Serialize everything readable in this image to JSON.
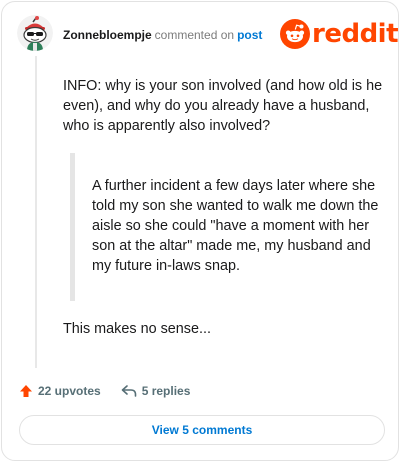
{
  "header": {
    "username": "Zonnebloempje",
    "commented_label": "commented on",
    "post_label": "post",
    "brand": "reddit"
  },
  "icons": {
    "avatar": "snoo-avatar-icon",
    "logo": "reddit-alien-icon",
    "upvote": "upvote-arrow-icon",
    "reply": "reply-arrow-icon"
  },
  "comment": {
    "body": "INFO: why is your son involved (and how old is he even), and why do you already have a husband, who is apparently also involved?",
    "quote": "A further incident a few days later where she told my son she wanted to walk me down the aisle so she could \"have a moment with her son at the altar\" made me, my husband and my future in-laws snap.",
    "closing": "This makes no sense..."
  },
  "actions": {
    "upvotes": "22 upvotes",
    "replies": "5 replies"
  },
  "footer": {
    "view_comments": "View 5 comments"
  },
  "colors": {
    "brand_orange": "#ff4500",
    "link_blue": "#0079d3",
    "muted_gray": "#576f76"
  }
}
